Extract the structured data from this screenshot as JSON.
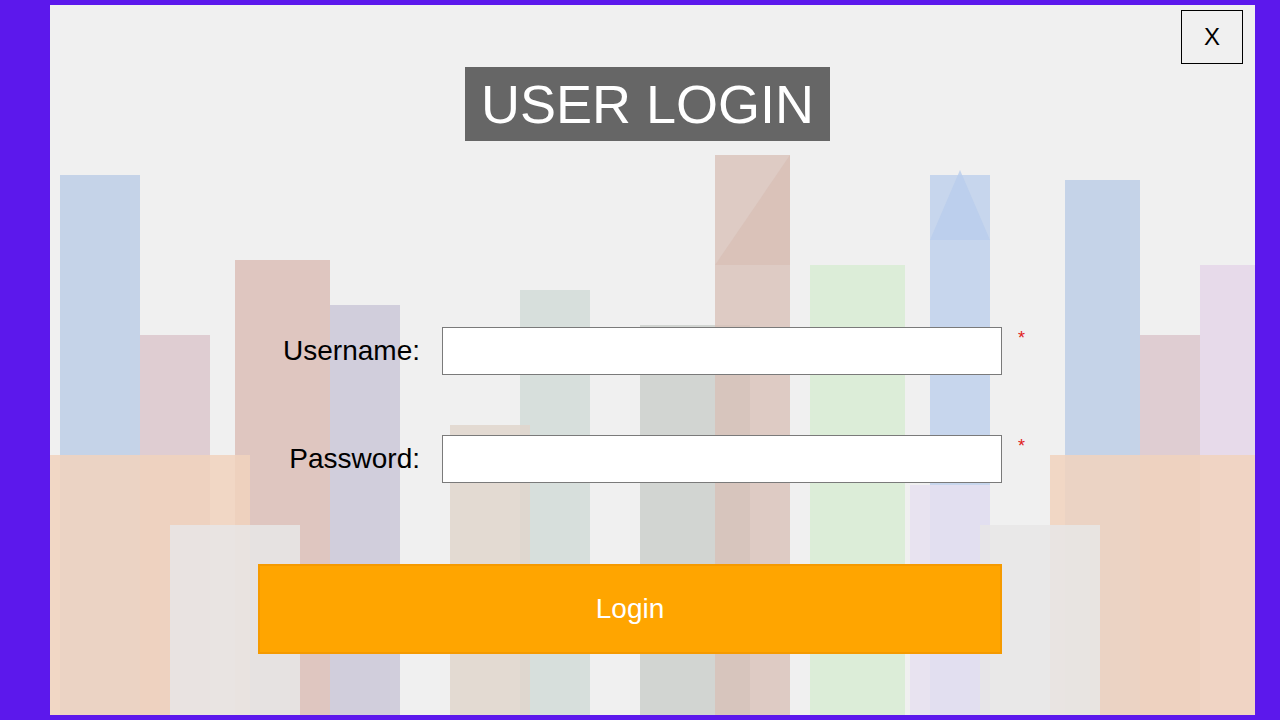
{
  "window": {
    "close_button": "X",
    "title": "USER LOGIN"
  },
  "fields": [
    {
      "label": "Username:",
      "value": "",
      "required_mark": "*",
      "kind": "text"
    },
    {
      "label": "Password:",
      "value": "",
      "required_mark": "*",
      "kind": "password"
    }
  ],
  "login_button": "Login"
}
